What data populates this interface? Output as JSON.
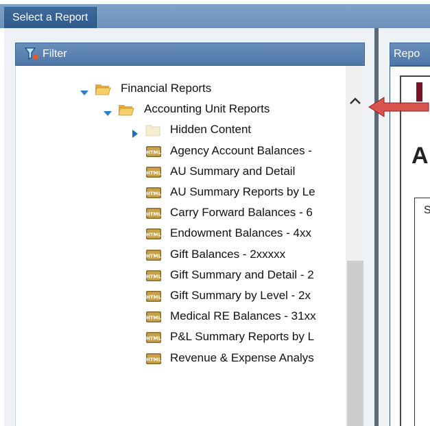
{
  "tab": {
    "label": "Select a Report"
  },
  "filter_panel": {
    "label": "Filter"
  },
  "report_panel": {
    "label": "Repo",
    "partial_heading": "A",
    "fieldset_char": "S"
  },
  "tree": [
    {
      "label": "Financial Reports",
      "type": "folder",
      "expanded": true,
      "level": 0
    },
    {
      "label": "Accounting Unit Reports",
      "type": "folder",
      "expanded": true,
      "level": 1
    },
    {
      "label": "Hidden Content",
      "type": "folder-empty",
      "expanded": false,
      "level": 2
    },
    {
      "label": "Agency Account Balances -",
      "type": "html",
      "level": 2
    },
    {
      "label": "AU Summary and Detail",
      "type": "html",
      "level": 2
    },
    {
      "label": "AU Summary Reports by Le",
      "type": "html",
      "level": 2
    },
    {
      "label": "Carry Forward Balances - 6",
      "type": "html",
      "level": 2
    },
    {
      "label": "Endowment Balances - 4xx",
      "type": "html",
      "level": 2
    },
    {
      "label": "Gift Balances - 2xxxxx",
      "type": "html",
      "level": 2
    },
    {
      "label": "Gift Summary and Detail - 2",
      "type": "html",
      "level": 2
    },
    {
      "label": "Gift Summary by Level - 2x",
      "type": "html",
      "level": 2
    },
    {
      "label": "Medical RE Balances - 31xx",
      "type": "html",
      "level": 2
    },
    {
      "label": "P&L Summary Reports by L",
      "type": "html",
      "level": 2
    },
    {
      "label": "Revenue & Expense Analys",
      "type": "html",
      "level": 2
    }
  ],
  "colors": {
    "header_blue": "#4f77a8",
    "arrow_red": "#d9534f",
    "folder_yellow": "#f2c14e",
    "expand_arrow": "#2a7fd4"
  }
}
